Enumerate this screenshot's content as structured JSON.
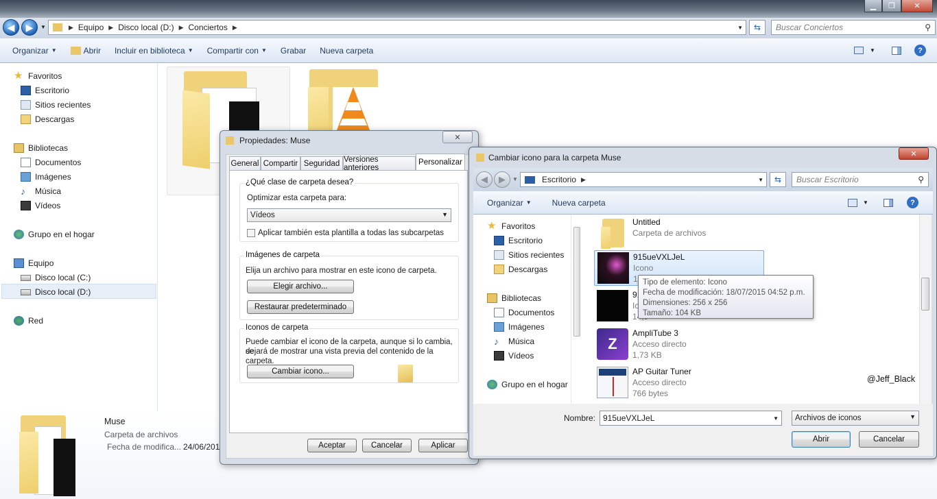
{
  "explorer": {
    "breadcrumb": [
      "Equipo",
      "Disco local (D:)",
      "Conciertos"
    ],
    "search_placeholder": "Buscar Conciertos",
    "window_controls": [
      "minimize-icon",
      "maximize-icon",
      "close-icon"
    ],
    "toolbar": {
      "organize": "Organizar",
      "open": "Abrir",
      "include_library": "Incluir en biblioteca",
      "share": "Compartir con",
      "burn": "Grabar",
      "new_folder": "Nueva carpeta"
    },
    "nav": {
      "favorites": "Favoritos",
      "desktop": "Escritorio",
      "recent": "Sitios recientes",
      "downloads": "Descargas",
      "libraries": "Bibliotecas",
      "documents": "Documentos",
      "images": "Imágenes",
      "music": "Música",
      "videos": "Vídeos",
      "homegroup": "Grupo en el hogar",
      "computer": "Equipo",
      "disk_c": "Disco local (C:)",
      "disk_d": "Disco local (D:)",
      "network": "Red"
    },
    "details": {
      "name": "Muse",
      "type": "Carpeta de archivos",
      "modified_label": "Fecha de modifica...",
      "modified_value": "24/06/201"
    }
  },
  "properties": {
    "title": "Propiedades: Muse",
    "tabs": [
      "General",
      "Compartir",
      "Seguridad",
      "Versiones anteriores",
      "Personalizar"
    ],
    "active_tab": "Personalizar",
    "folder_type_group": "¿Qué clase de carpeta desea?",
    "optimize_label": "Optimizar esta carpeta para:",
    "optimize_value": "Vídeos",
    "apply_subfolders": "Aplicar también esta plantilla a todas las subcarpetas",
    "folder_images_group": "Imágenes de carpeta",
    "folder_images_desc": "Elija un archivo para mostrar en este icono de carpeta.",
    "choose_file": "Elegir archivo...",
    "restore_default": "Restaurar predeterminado",
    "folder_icons_group": "Iconos de carpeta",
    "folder_icons_desc1": "Puede cambiar el icono de la carpeta, aunque si lo cambia, se",
    "folder_icons_desc2": "dejará de mostrar una vista previa del contenido de la carpeta.",
    "change_icon": "Cambiar icono...",
    "ok": "Aceptar",
    "cancel": "Cancelar",
    "apply": "Aplicar"
  },
  "change_icon": {
    "title": "Cambiar icono para la carpeta Muse",
    "location": "Escritorio",
    "search_placeholder": "Buscar Escritorio",
    "toolbar": {
      "organize": "Organizar",
      "new_folder": "Nueva carpeta"
    },
    "nav": {
      "favorites": "Favoritos",
      "desktop": "Escritorio",
      "recent": "Sitios recientes",
      "downloads": "Descargas",
      "libraries": "Bibliotecas",
      "documents": "Documentos",
      "images": "Imágenes",
      "music": "Música",
      "videos": "Vídeos",
      "homegroup": "Grupo en el hogar"
    },
    "files": [
      {
        "name": "Untitled",
        "type": "Carpeta de archivos",
        "size": ""
      },
      {
        "name": "915ueVXLJeL",
        "type": "Icono",
        "size": "104"
      },
      {
        "name": "915",
        "type": "Ico",
        "size": "14,9"
      },
      {
        "name": "AmpliTube 3",
        "type": "Acceso directo",
        "size": "1,73 KB"
      },
      {
        "name": "AP Guitar Tuner",
        "type": "Acceso directo",
        "size": "766 bytes"
      }
    ],
    "tooltip": {
      "type": "Tipo de elemento: Icono",
      "modified": "Fecha de modificación: 18/07/2015 04:52 p.m.",
      "dimensions": "Dimensiones: 256 x 256",
      "size": "Tamaño: 104 KB"
    },
    "watermark": "@Jeff_Black",
    "name_label": "Nombre:",
    "name_value": "915ueVXLJeL",
    "filter_value": "Archivos de iconos",
    "open": "Abrir",
    "cancel": "Cancelar"
  }
}
